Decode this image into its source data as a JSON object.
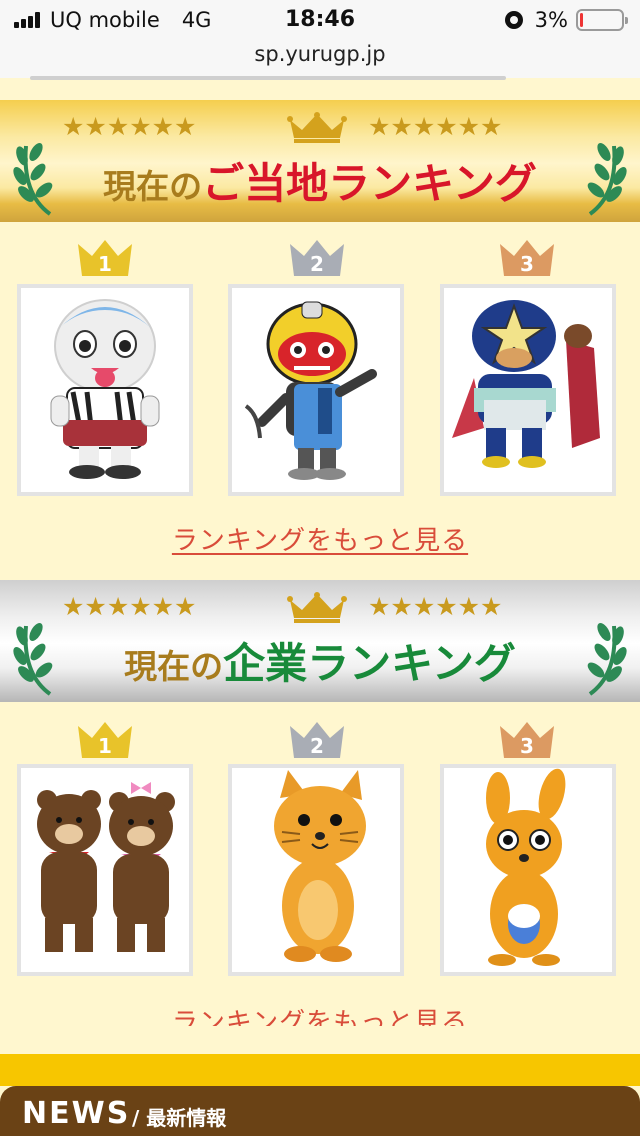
{
  "status_bar": {
    "carrier": "UQ mobile",
    "network": "4G",
    "time": "18:46",
    "battery": "3%"
  },
  "browser": {
    "url": "sp.yurugp.jp"
  },
  "sections": [
    {
      "title_prefix": "現在の",
      "title_main": "ご当地ランキング",
      "ranks": [
        "1",
        "2",
        "3"
      ],
      "more_link": "ランキングをもっと見る"
    },
    {
      "title_prefix": "現在の",
      "title_main": "企業ランキング",
      "ranks": [
        "1",
        "2",
        "3"
      ],
      "more_link": "ランキングをもっと見る"
    }
  ],
  "news": {
    "title": "NEWS",
    "separator": "/",
    "subtitle": "最新情報"
  },
  "colors": {
    "gold_crown": "#e8c32a",
    "silver_crown": "#a9adb5",
    "bronze_crown": "#dc9a62",
    "news_bar": "#6a4215",
    "link": "#d94c3a"
  }
}
